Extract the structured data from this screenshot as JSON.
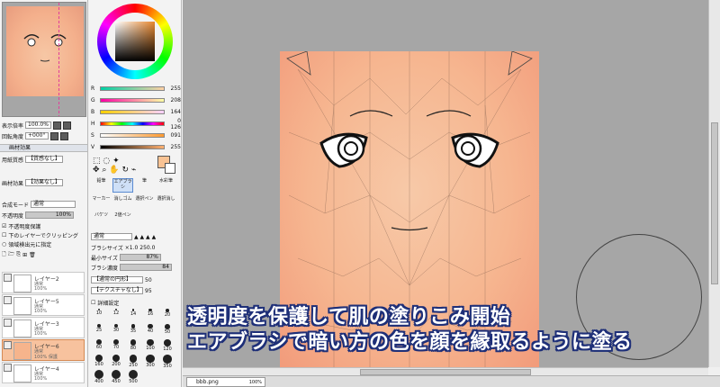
{
  "navigator": {
    "zoom_label": "表示倍率",
    "zoom_value": "100.0%",
    "angle_label": "回転角度",
    "angle_value": "+000°"
  },
  "paper": {
    "header": "画材効果",
    "texture_label": "用紙質感",
    "texture_value": "【質感なし】",
    "effect_label": "画材効果",
    "effect_value": "【効果なし】",
    "blend_label": "合成モード",
    "blend_value": "通常",
    "opacity_label": "不透明度",
    "opacity_value": "100%",
    "check_protect": "不透明度保護",
    "check_clip": "下のレイヤーでクリッピング",
    "check_select": "領域検出元に指定"
  },
  "layers": [
    {
      "name": "レイヤー2",
      "mode": "通常",
      "opacity": "100%"
    },
    {
      "name": "レイヤー5",
      "mode": "通常",
      "opacity": "100%"
    },
    {
      "name": "レイヤー3",
      "mode": "通常",
      "opacity": "100%"
    },
    {
      "name": "レイヤー6",
      "mode": "通常",
      "opacity": "100% 保護"
    },
    {
      "name": "レイヤー4",
      "mode": "通常",
      "opacity": "100%"
    }
  ],
  "color": {
    "current_color": "#f9c394",
    "sliders": [
      {
        "label": "R",
        "value": "255"
      },
      {
        "label": "G",
        "value": "208"
      },
      {
        "label": "B",
        "value": "164"
      },
      {
        "label": "H",
        "value": "0 126"
      },
      {
        "label": "S",
        "value": "091"
      },
      {
        "label": "V",
        "value": "255"
      }
    ]
  },
  "tools": {
    "row1": [
      "鉛筆",
      "エアブラシ",
      "筆",
      "水彩筆"
    ],
    "row2": [
      "マーカー",
      "消しゴム",
      "選択ペン",
      "選択消し"
    ],
    "row3": [
      "バケツ",
      "2値ペン",
      "",
      ""
    ]
  },
  "brush": {
    "mode": "通常",
    "size_label": "ブラシサイズ",
    "size_mult": "×1.0",
    "size_value": "250.0",
    "min_label": "最小サイズ",
    "min_value": "87%",
    "density_label": "ブラシ濃度",
    "density_value": "84",
    "shape_value": "【通常の円形】",
    "shape_num": "50",
    "texture_value": "【テクスチャなし】",
    "texture_num": "95",
    "detail_label": "詳細設定",
    "sizes": [
      "10",
      "12",
      "14",
      "16",
      "20",
      "25",
      "30",
      "35",
      "40",
      "50",
      "60",
      "70",
      "80",
      "100",
      "120",
      "160",
      "200",
      "250",
      "300",
      "350",
      "400",
      "450",
      "500"
    ]
  },
  "document": {
    "tab_name": "bbb.png",
    "tab_zoom": "100%"
  },
  "caption": {
    "line1": "透明度を保護して肌の塗りこみ開始",
    "line2": "エアブラシで暗い方の色を顔を縁取るように塗る"
  }
}
